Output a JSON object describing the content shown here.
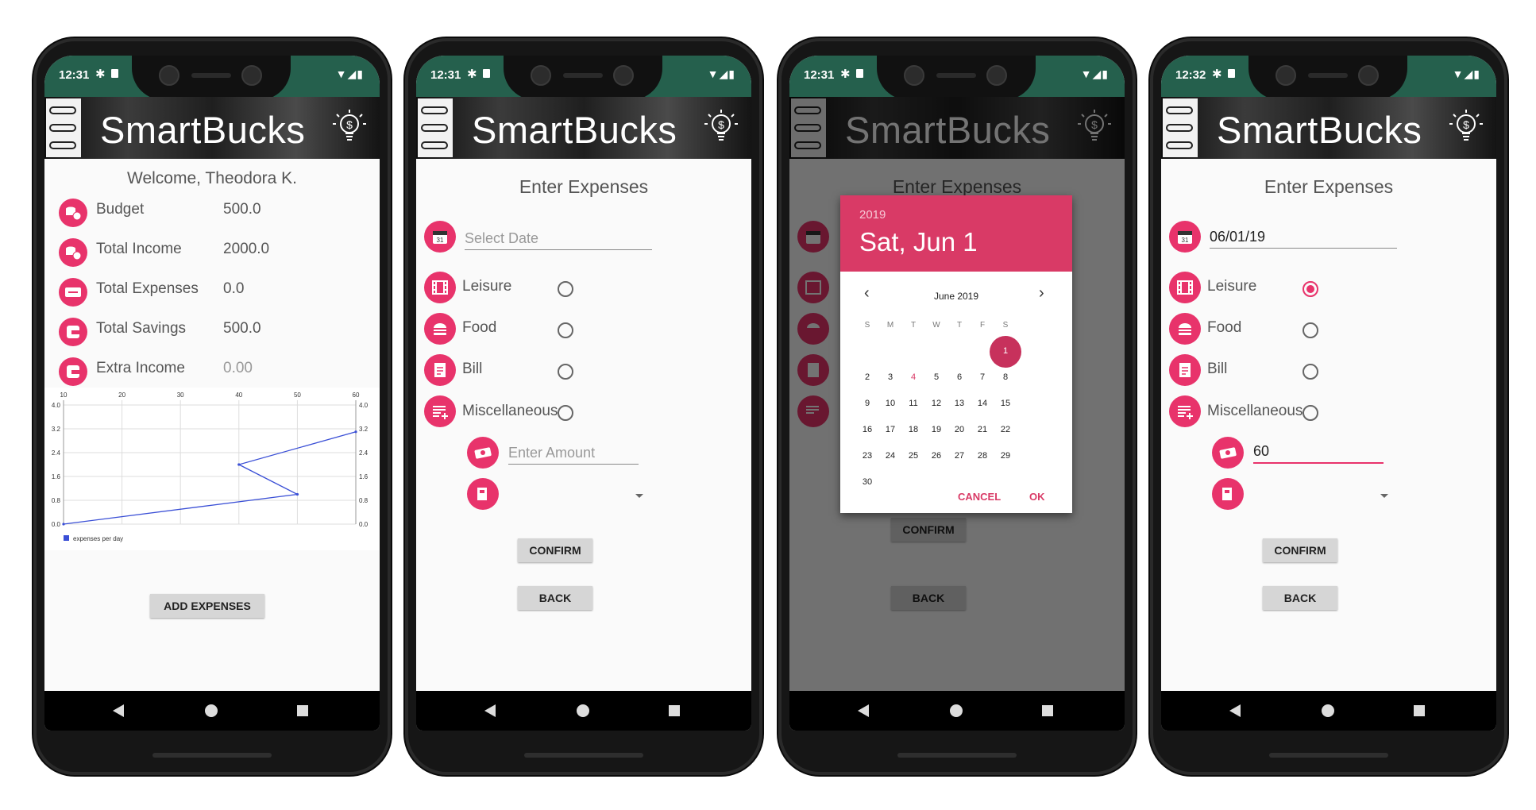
{
  "app": {
    "brand": "SmartBucks"
  },
  "colors": {
    "accent": "#e8336b",
    "status_bar": "#25604d",
    "dialog_header": "#d93a66"
  },
  "screen1": {
    "status": {
      "time": "12:31"
    },
    "welcome": "Welcome, Theodora K.",
    "rows": [
      {
        "label": "Budget",
        "value": "500.0",
        "icon": "budget-coins-icon"
      },
      {
        "label": "Total Income",
        "value": "2000.0",
        "icon": "income-coins-icon"
      },
      {
        "label": "Total Expenses",
        "value": "0.0",
        "icon": "expenses-icon"
      },
      {
        "label": "Total Savings",
        "value": "500.0",
        "icon": "wallet-icon"
      },
      {
        "label": "Extra Income",
        "value": "0.00",
        "icon": "wallet-icon"
      }
    ],
    "add_expenses_label": "ADD EXPENSES"
  },
  "chart_data": {
    "type": "line",
    "x_ticks": [
      "10",
      "20",
      "30",
      "40",
      "50",
      "60"
    ],
    "y_ticks": [
      "0.0",
      "0.8",
      "1.6",
      "2.4",
      "3.2",
      "4.0"
    ],
    "xlim": [
      10,
      60
    ],
    "ylim": [
      0,
      4
    ],
    "series": [
      {
        "name": "expenses per day",
        "x": [
          10,
          50,
          40,
          60
        ],
        "y": [
          0.0,
          1.0,
          2.0,
          3.1
        ],
        "color": "#3a4fd6"
      }
    ],
    "legend": "bottom-left",
    "grid": true
  },
  "expense_form": {
    "title": "Enter Expenses",
    "date_placeholder": "Select Date",
    "categories": [
      {
        "label": "Leisure",
        "icon": "film-icon"
      },
      {
        "label": "Food",
        "icon": "burger-icon"
      },
      {
        "label": "Bill",
        "icon": "bill-icon"
      },
      {
        "label": "Miscellaneous",
        "icon": "list-add-icon"
      }
    ],
    "amount_placeholder": "Enter Amount",
    "confirm_label": "CONFIRM",
    "back_label": "BACK"
  },
  "screen2": {
    "status": {
      "time": "12:31"
    }
  },
  "screen3": {
    "status": {
      "time": "12:31"
    },
    "dialog": {
      "year": "2019",
      "date": "Sat, Jun 1",
      "month": "June 2019",
      "weekdays": [
        "S",
        "M",
        "T",
        "W",
        "T",
        "F",
        "S"
      ],
      "weeks": [
        [
          "",
          "",
          "",
          "",
          "",
          "",
          "1"
        ],
        [
          "2",
          "3",
          "4",
          "5",
          "6",
          "7",
          "8"
        ],
        [
          "9",
          "10",
          "11",
          "12",
          "13",
          "14",
          "15"
        ],
        [
          "16",
          "17",
          "18",
          "19",
          "20",
          "21",
          "22"
        ],
        [
          "23",
          "24",
          "25",
          "26",
          "27",
          "28",
          "29"
        ],
        [
          "30",
          "",
          "",
          "",
          "",
          "",
          ""
        ]
      ],
      "selected_day": "1",
      "today_day": "4",
      "cancel_label": "CANCEL",
      "ok_label": "OK"
    }
  },
  "screen4": {
    "status": {
      "time": "12:32"
    },
    "date_value": "06/01/19",
    "amount_value": "60",
    "selected_category": "Leisure"
  }
}
